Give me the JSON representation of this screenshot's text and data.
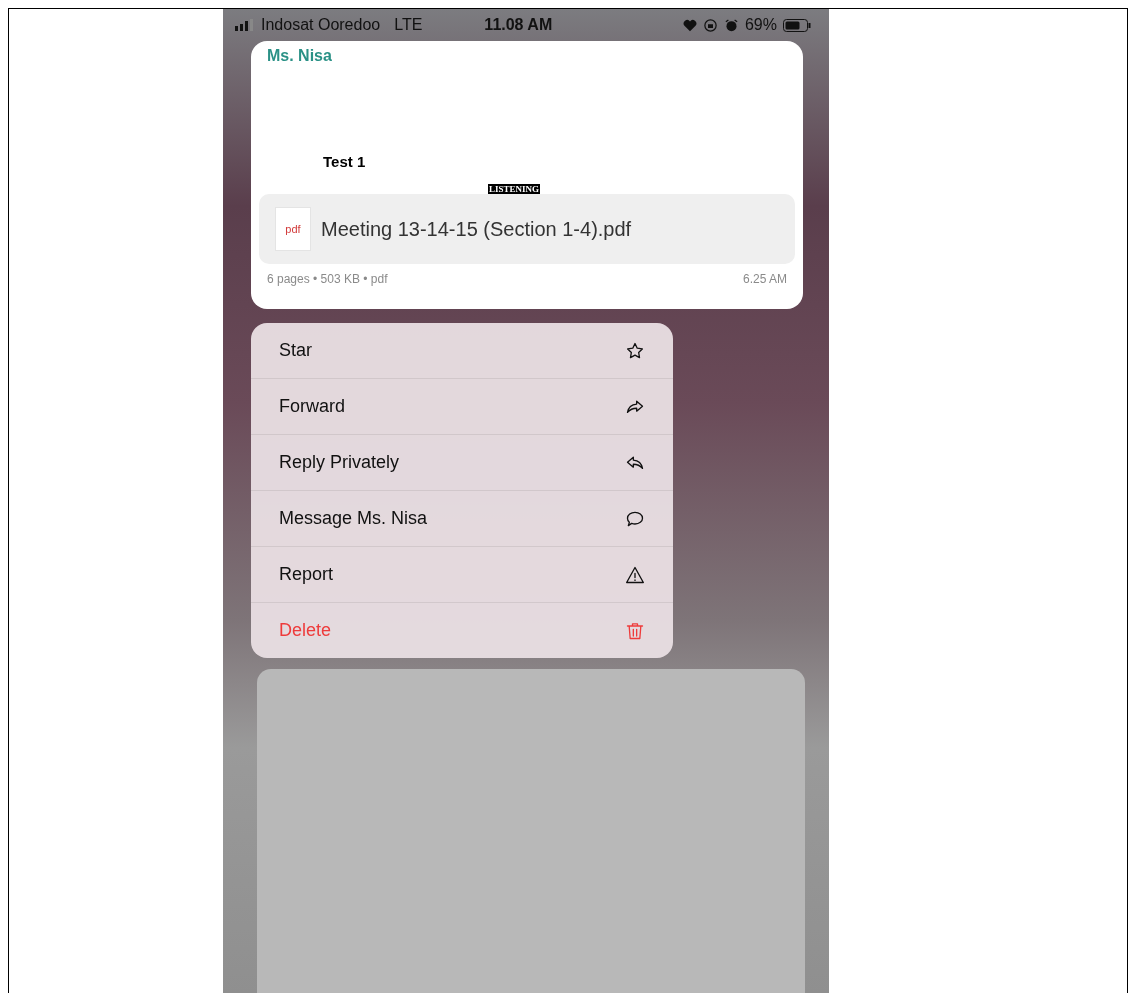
{
  "status_bar": {
    "carrier": "Indosat Ooredoo",
    "network": "LTE",
    "time": "11.08 AM",
    "battery": "69%"
  },
  "message": {
    "sender": "Ms. Nisa",
    "preview_heading": "Test 1",
    "preview_label": "LISTENING",
    "file_type_badge": "pdf",
    "file_name": "Meeting 13-14-15 (Section 1-4).pdf",
    "meta": "6 pages • 503 KB • pdf",
    "time": "6.25 AM"
  },
  "menu": [
    {
      "label": "Star",
      "kind": "star"
    },
    {
      "label": "Forward",
      "kind": "forward"
    },
    {
      "label": "Reply Privately",
      "kind": "reply"
    },
    {
      "label": "Message Ms. Nisa",
      "kind": "message"
    },
    {
      "label": "Report",
      "kind": "report"
    },
    {
      "label": "Delete",
      "kind": "delete"
    }
  ]
}
